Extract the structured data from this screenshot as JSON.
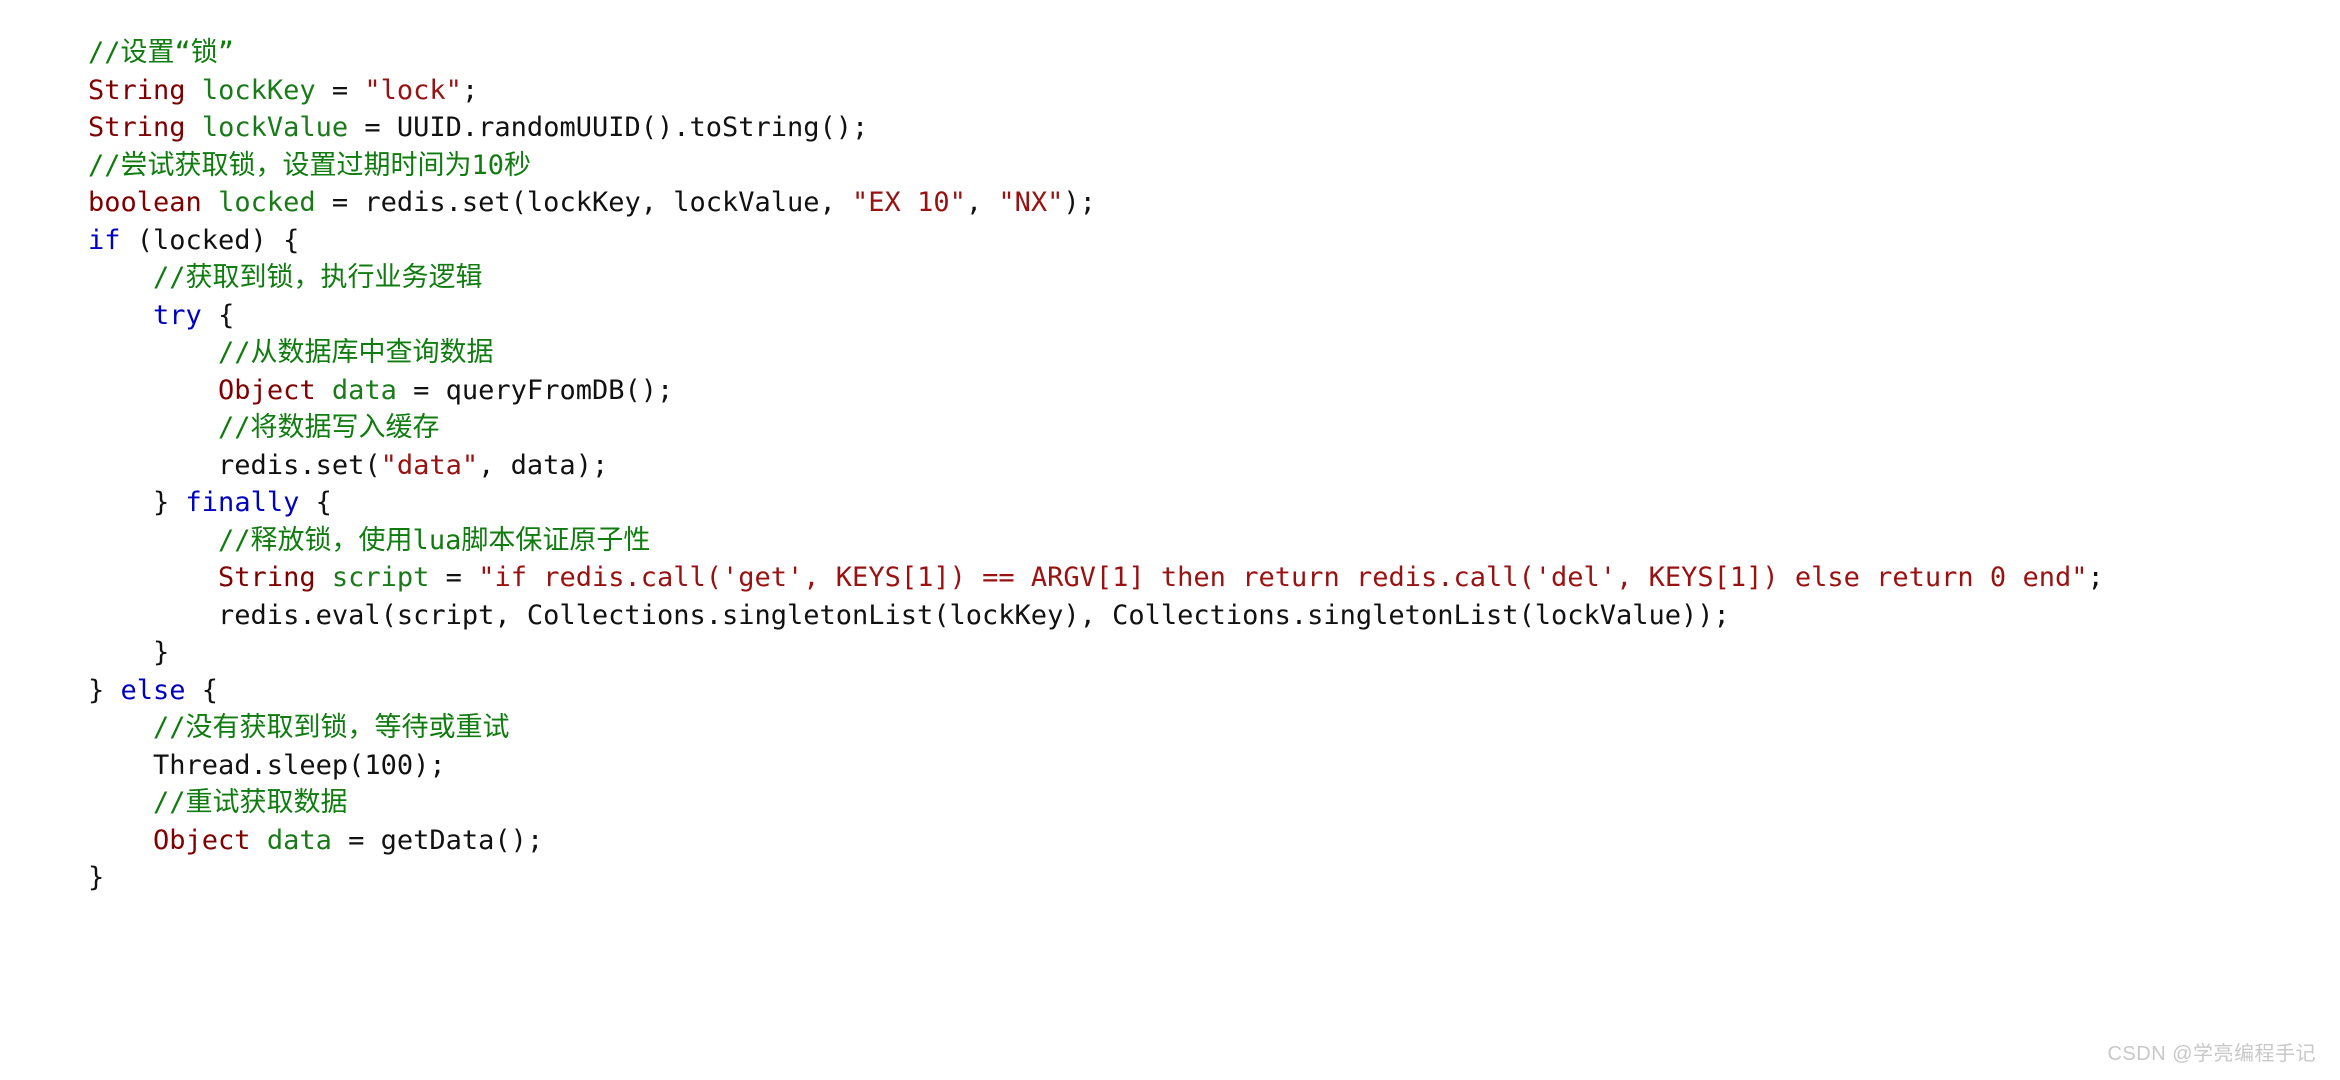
{
  "document": {
    "type": "code-snippet",
    "language": "java",
    "background_color": "#ffffff"
  },
  "colors": {
    "keyword": "#7f0000",
    "control_keyword": "#0000c0",
    "identifier": "#1a7a1a",
    "string": "#991111",
    "comment": "#107c10",
    "plain": "#111111",
    "watermark": "#c8c8c8"
  },
  "code": {
    "lines": [
      {
        "id": 1,
        "tokens": [
          {
            "t": "cmt",
            "v": "//设置“锁”"
          }
        ]
      },
      {
        "id": 2,
        "tokens": [
          {
            "t": "kw",
            "v": "String"
          },
          {
            "t": "pln",
            "v": " "
          },
          {
            "t": "var",
            "v": "lockKey"
          },
          {
            "t": "pln",
            "v": " = "
          },
          {
            "t": "str",
            "v": "\"lock\""
          },
          {
            "t": "pln",
            "v": ";"
          }
        ]
      },
      {
        "id": 3,
        "tokens": [
          {
            "t": "kw",
            "v": "String"
          },
          {
            "t": "pln",
            "v": " "
          },
          {
            "t": "var",
            "v": "lockValue"
          },
          {
            "t": "pln",
            "v": " = UUID.randomUUID().toString();"
          }
        ]
      },
      {
        "id": 4,
        "tokens": [
          {
            "t": "cmt",
            "v": "//尝试获取锁，设置过期时间为10秒"
          }
        ]
      },
      {
        "id": 5,
        "tokens": [
          {
            "t": "kw",
            "v": "boolean"
          },
          {
            "t": "pln",
            "v": " "
          },
          {
            "t": "var",
            "v": "locked"
          },
          {
            "t": "pln",
            "v": " = redis.set(lockKey, lockValue, "
          },
          {
            "t": "str",
            "v": "\"EX 10\""
          },
          {
            "t": "pln",
            "v": ", "
          },
          {
            "t": "str",
            "v": "\"NX\""
          },
          {
            "t": "pln",
            "v": ");"
          }
        ]
      },
      {
        "id": 6,
        "tokens": [
          {
            "t": "kw2",
            "v": "if"
          },
          {
            "t": "pln",
            "v": " (locked) {"
          }
        ]
      },
      {
        "id": 7,
        "tokens": [
          {
            "t": "pln",
            "v": "    "
          },
          {
            "t": "cmt",
            "v": "//获取到锁，执行业务逻辑"
          }
        ]
      },
      {
        "id": 8,
        "tokens": [
          {
            "t": "pln",
            "v": "    "
          },
          {
            "t": "kw2",
            "v": "try"
          },
          {
            "t": "pln",
            "v": " {"
          }
        ]
      },
      {
        "id": 9,
        "tokens": [
          {
            "t": "pln",
            "v": "        "
          },
          {
            "t": "cmt",
            "v": "//从数据库中查询数据"
          }
        ]
      },
      {
        "id": 10,
        "tokens": [
          {
            "t": "pln",
            "v": "        "
          },
          {
            "t": "kw",
            "v": "Object"
          },
          {
            "t": "pln",
            "v": " "
          },
          {
            "t": "var",
            "v": "data"
          },
          {
            "t": "pln",
            "v": " = queryFromDB();"
          }
        ]
      },
      {
        "id": 11,
        "tokens": [
          {
            "t": "pln",
            "v": "        "
          },
          {
            "t": "cmt",
            "v": "//将数据写入缓存"
          }
        ]
      },
      {
        "id": 12,
        "tokens": [
          {
            "t": "pln",
            "v": "        redis.set("
          },
          {
            "t": "str",
            "v": "\"data\""
          },
          {
            "t": "pln",
            "v": ", data);"
          }
        ]
      },
      {
        "id": 13,
        "tokens": [
          {
            "t": "pln",
            "v": "    } "
          },
          {
            "t": "kw2",
            "v": "finally"
          },
          {
            "t": "pln",
            "v": " {"
          }
        ]
      },
      {
        "id": 14,
        "tokens": [
          {
            "t": "pln",
            "v": "        "
          },
          {
            "t": "cmt",
            "v": "//释放锁，使用lua脚本保证原子性"
          }
        ]
      },
      {
        "id": 15,
        "tokens": [
          {
            "t": "pln",
            "v": "        "
          },
          {
            "t": "kw",
            "v": "String"
          },
          {
            "t": "pln",
            "v": " "
          },
          {
            "t": "var",
            "v": "script"
          },
          {
            "t": "pln",
            "v": " = "
          },
          {
            "t": "str",
            "v": "\"if redis.call('get', KEYS[1]) == ARGV[1] then return redis.call('del', KEYS[1]) else return 0 end\""
          },
          {
            "t": "pln",
            "v": ";"
          }
        ]
      },
      {
        "id": 16,
        "tokens": [
          {
            "t": "pln",
            "v": "        redis.eval(script, Collections.singletonList(lockKey), Collections.singletonList(lockValue));"
          }
        ]
      },
      {
        "id": 17,
        "tokens": [
          {
            "t": "pln",
            "v": "    }"
          }
        ]
      },
      {
        "id": 18,
        "tokens": [
          {
            "t": "pln",
            "v": "} "
          },
          {
            "t": "kw2",
            "v": "else"
          },
          {
            "t": "pln",
            "v": " {"
          }
        ]
      },
      {
        "id": 19,
        "tokens": [
          {
            "t": "pln",
            "v": "    "
          },
          {
            "t": "cmt",
            "v": "//没有获取到锁，等待或重试"
          }
        ]
      },
      {
        "id": 20,
        "tokens": [
          {
            "t": "pln",
            "v": "    Thread.sleep(100);"
          }
        ]
      },
      {
        "id": 21,
        "tokens": [
          {
            "t": "pln",
            "v": "    "
          },
          {
            "t": "cmt",
            "v": "//重试获取数据"
          }
        ]
      },
      {
        "id": 22,
        "tokens": [
          {
            "t": "pln",
            "v": "    "
          },
          {
            "t": "kw",
            "v": "Object"
          },
          {
            "t": "pln",
            "v": " "
          },
          {
            "t": "var",
            "v": "data"
          },
          {
            "t": "pln",
            "v": " = getData();"
          }
        ]
      },
      {
        "id": 23,
        "tokens": [
          {
            "t": "pln",
            "v": "}"
          }
        ]
      }
    ]
  },
  "watermark": {
    "text": "CSDN @学亮编程手记"
  }
}
